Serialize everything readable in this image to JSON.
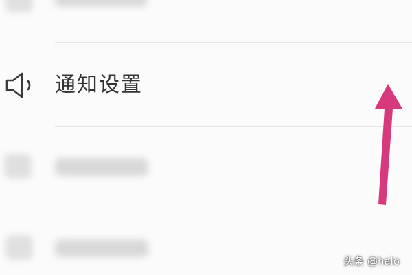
{
  "settings_list": {
    "notification_item": {
      "label": "通知设置",
      "icon": "speaker-icon"
    }
  },
  "annotation": {
    "arrow_color": "#d63a7d",
    "arrow_direction": "up"
  },
  "watermark": {
    "text": "头条 @halo"
  }
}
